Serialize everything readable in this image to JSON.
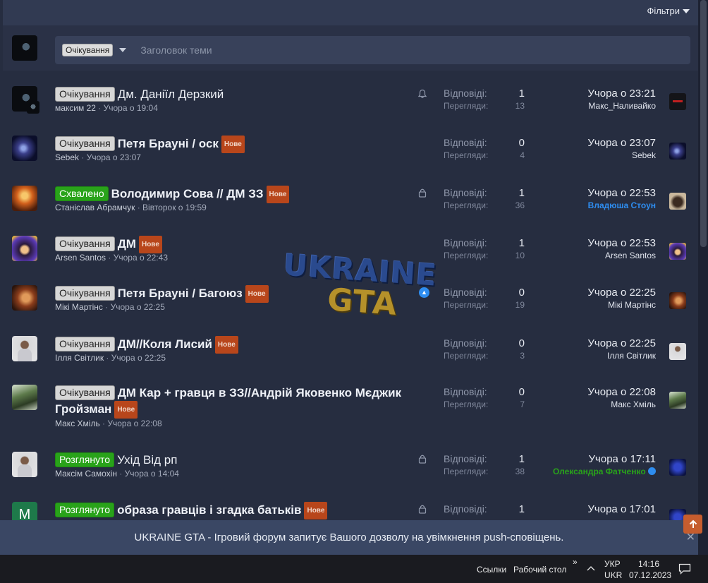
{
  "header": {
    "filters_label": "Фільтри"
  },
  "new_thread": {
    "prefix": "Очікування",
    "placeholder": "Заголовок теми"
  },
  "stats_labels": {
    "replies": "Відповіді:",
    "views": "Перегляди:"
  },
  "threads": [
    {
      "prefix": "Очікування",
      "prefix_type": "wait",
      "title": "Дм. Даніїл Дерзкий",
      "bold": false,
      "new": false,
      "author": "максим 22",
      "date": "Учора о 19:04",
      "replies": "1",
      "views": "13",
      "last_date": "Учора о 23:21",
      "last_user": "Макс_Наливайко",
      "last_user_style": "normal",
      "icon": "bell-icon"
    },
    {
      "prefix": "Очікування",
      "prefix_type": "wait",
      "title": "Петя Брауні / оск",
      "bold": true,
      "new": true,
      "author": "Sebek",
      "date": "Учора о 23:07",
      "replies": "0",
      "views": "4",
      "last_date": "Учора о 23:07",
      "last_user": "Sebek",
      "last_user_style": "normal",
      "icon": ""
    },
    {
      "prefix": "Схвалено",
      "prefix_type": "approved",
      "title": "Володимир Сова // ДМ ЗЗ",
      "bold": true,
      "new": true,
      "author": "Станіслав Абрамчук",
      "date": "Вівторок о 19:59",
      "replies": "1",
      "views": "36",
      "last_date": "Учора о 22:53",
      "last_user": "Владюша Стоун",
      "last_user_style": "blue",
      "icon": "lock-icon"
    },
    {
      "prefix": "Очікування",
      "prefix_type": "wait",
      "title": "ДМ",
      "bold": true,
      "new": true,
      "author": "Arsen Santos",
      "date": "Учора о 22:43",
      "replies": "1",
      "views": "10",
      "last_date": "Учора о 22:53",
      "last_user": "Arsen Santos",
      "last_user_style": "normal",
      "icon": ""
    },
    {
      "prefix": "Очікування",
      "prefix_type": "wait",
      "title": "Петя Брауні / Багоюз",
      "bold": true,
      "new": true,
      "author": "Мікі Мартінс",
      "date": "Учора о 22:25",
      "replies": "0",
      "views": "19",
      "last_date": "Учора о 22:25",
      "last_user": "Мікі Мартінс",
      "last_user_style": "normal",
      "icon": "thumbs-up-icon"
    },
    {
      "prefix": "Очікування",
      "prefix_type": "wait",
      "title": "ДМ//Коля Лисий",
      "bold": true,
      "new": true,
      "author": "Ілля Світлик",
      "date": "Учора о 22:25",
      "replies": "0",
      "views": "3",
      "last_date": "Учора о 22:25",
      "last_user": "Ілля Світлик",
      "last_user_style": "normal",
      "icon": ""
    },
    {
      "prefix": "Очікування",
      "prefix_type": "wait",
      "title": "ДМ Кар + гравця в ЗЗ//Андрій Яковенко Мєджик Гройзман",
      "bold": true,
      "new": true,
      "author": "Макс Хміль",
      "date": "Учора о 22:08",
      "replies": "0",
      "views": "7",
      "last_date": "Учора о 22:08",
      "last_user": "Макс Хміль",
      "last_user_style": "normal",
      "icon": ""
    },
    {
      "prefix": "Розглянуто",
      "prefix_type": "reviewed",
      "title": "Ухід Від рп",
      "bold": false,
      "new": false,
      "author": "Максім Самохін",
      "date": "Учора о 14:04",
      "replies": "1",
      "views": "38",
      "last_date": "Учора о 17:11",
      "last_user": "Олександра Фатченко",
      "last_user_style": "green",
      "icon": "lock-icon"
    },
    {
      "prefix": "Розглянуто",
      "prefix_type": "reviewed",
      "title": "образа гравців і згадка батьків",
      "bold": true,
      "new": true,
      "author": "",
      "date": "",
      "replies": "1",
      "views": "",
      "last_date": "Учора о 17:01",
      "last_user": "",
      "last_user_style": "green",
      "icon": "lock-icon",
      "avatar_letter": "M"
    }
  ],
  "new_badge": "Нове",
  "watermark": {
    "line1": "UKRAINE",
    "line2": "GTA"
  },
  "push_notice": "UKRAINE GTA - Ігровий форум запитує Вашого дозволу на увімкнення push-сповіщень.",
  "taskbar": {
    "links": "Ссылки",
    "desktop": "Рабочий стол",
    "expand": "»",
    "lang1": "УКР",
    "lang2": "UKR",
    "time": "14:16",
    "date": "07.12.2023"
  }
}
